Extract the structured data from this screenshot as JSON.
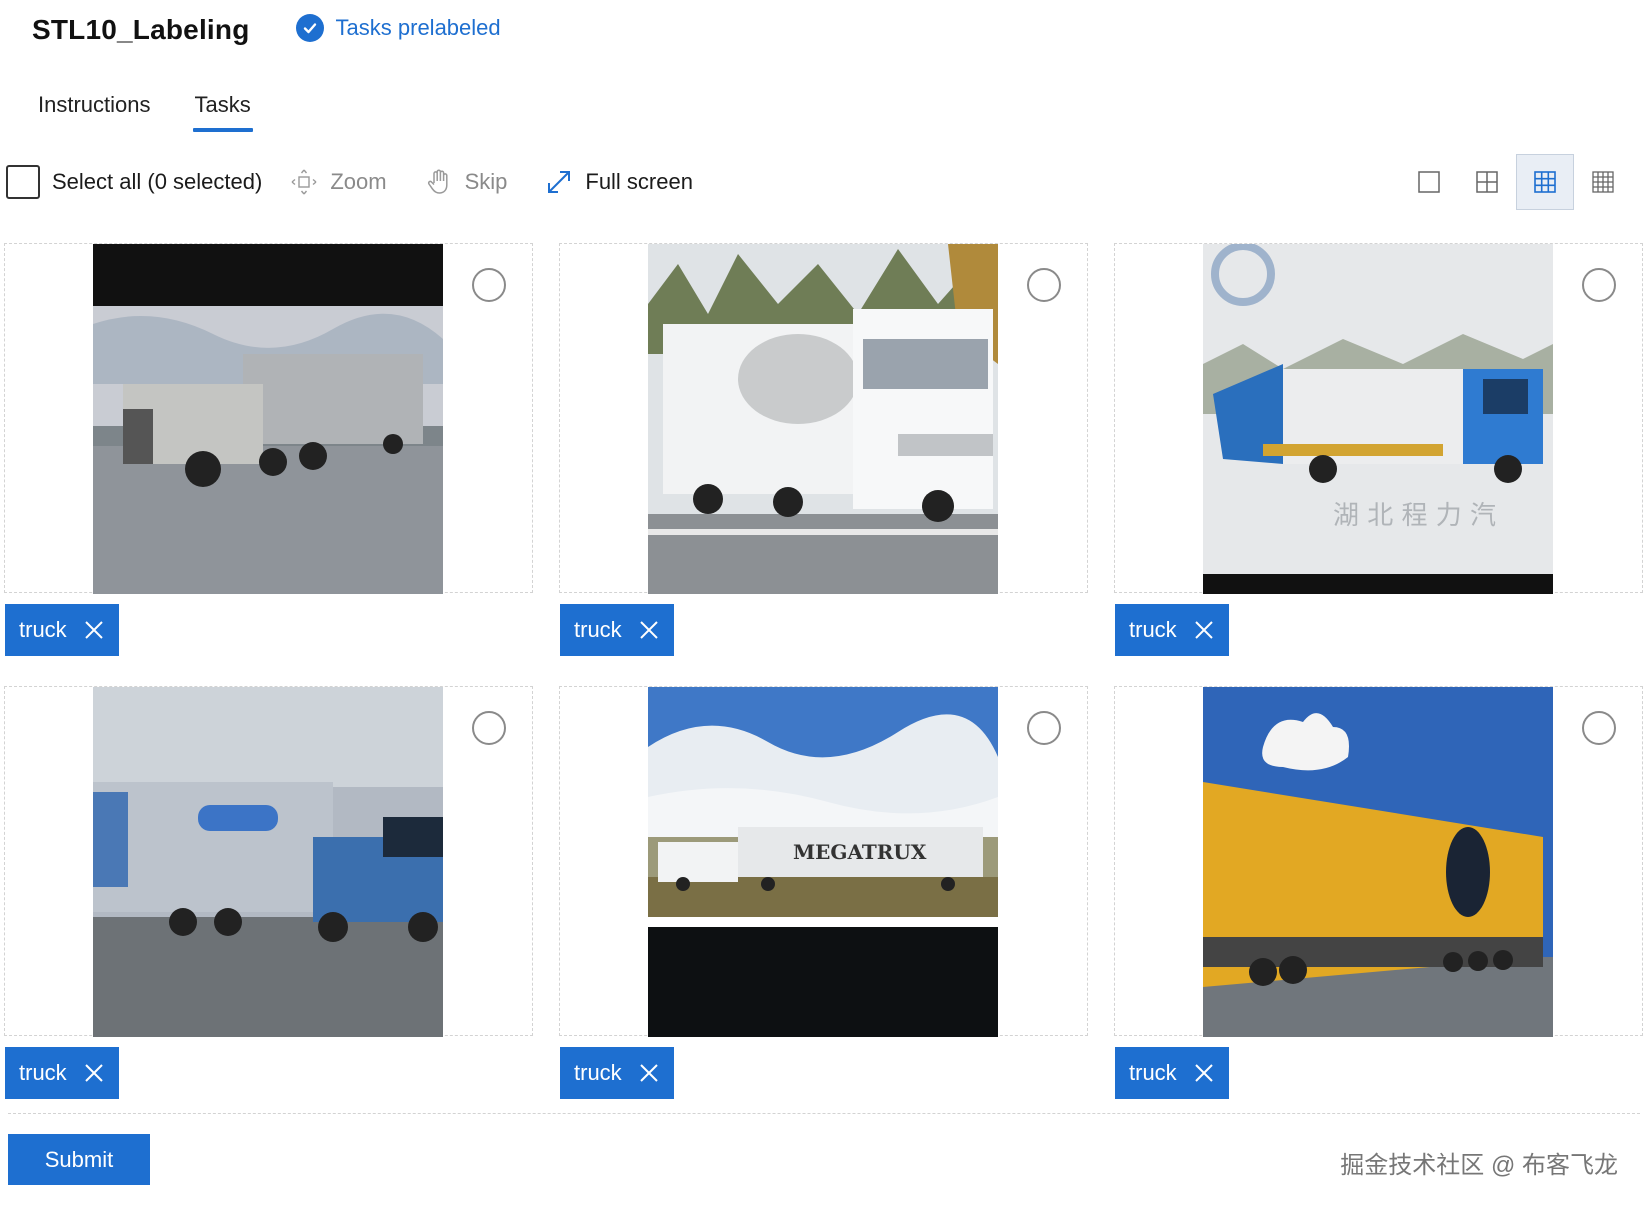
{
  "header": {
    "title": "STL10_Labeling",
    "status_label": "Tasks prelabeled",
    "status_icon": "check-circle-icon",
    "accent_color": "#1e6fd0"
  },
  "tabs": [
    {
      "label": "Instructions",
      "active": false
    },
    {
      "label": "Tasks",
      "active": true
    }
  ],
  "toolbar": {
    "select_all_label": "Select all (0 selected)",
    "zoom_label": "Zoom",
    "skip_label": "Skip",
    "fullscreen_label": "Full screen",
    "view_modes": [
      "single-view-icon",
      "grid-2x2-icon",
      "grid-3x3-icon",
      "grid-4x4-icon"
    ],
    "active_view": "grid-3x3-icon"
  },
  "images": [
    {
      "label": "truck",
      "scene": "pickup-semi-truck"
    },
    {
      "label": "truck",
      "scene": "white-box-truck"
    },
    {
      "label": "truck",
      "scene": "blue-garbage-truck"
    },
    {
      "label": "truck",
      "scene": "blue-semi-trailer"
    },
    {
      "label": "truck",
      "scene": "megatrux-semi"
    },
    {
      "label": "truck",
      "scene": "yellow-trailer"
    }
  ],
  "footer": {
    "submit_label": "Submit",
    "watermark": "掘金技术社区 @ 布客飞龙"
  }
}
